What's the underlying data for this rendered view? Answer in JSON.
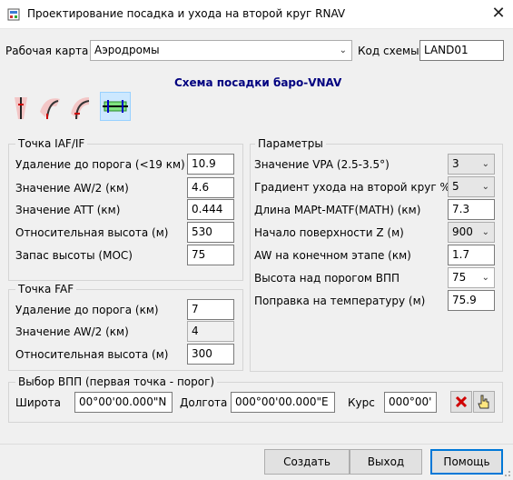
{
  "window": {
    "title": "Проектирование посадка и ухода на второй круг RNAV",
    "close_glyph": "✕"
  },
  "top": {
    "map_label": "Рабочая карта",
    "map_value": "Аэродромы",
    "scheme_code_label": "Код схемы",
    "scheme_code_value": "LAND01"
  },
  "heading": "Схема посадки баро-VNAV",
  "scheme_icons": [
    "approach-scheme-1-icon",
    "approach-scheme-2-icon",
    "approach-scheme-3-icon",
    "approach-scheme-4-icon"
  ],
  "iaf": {
    "legend": "Точка IAF/IF",
    "rows": [
      {
        "label": "Удаление до порога (<19 км)",
        "value": "10.9"
      },
      {
        "label": "Значение AW/2 (км)",
        "value": "4.6"
      },
      {
        "label": "Значение ATT (км)",
        "value": "0.444"
      },
      {
        "label": "Относительная высота (м)",
        "value": "530"
      },
      {
        "label": "Запас высоты (MOC)",
        "value": "75"
      }
    ]
  },
  "faf": {
    "legend": "Точка FAF",
    "rows": [
      {
        "label": "Удаление до порога (км)",
        "value": "7"
      },
      {
        "label": "Значение AW/2 (км)",
        "value": "4"
      },
      {
        "label": "Относительная высота (м)",
        "value": "300"
      }
    ]
  },
  "params": {
    "legend": "Параметры",
    "rows": [
      {
        "label": "Значение VPA (2.5-3.5°)",
        "value": "3",
        "type": "combo-disabled"
      },
      {
        "label": "Градиент ухода на второй круг %",
        "value": "5",
        "type": "combo-disabled"
      },
      {
        "label": "Длина MAPt-MATF(MATH) (км)",
        "value": "7.3",
        "type": "input"
      },
      {
        "label": "Начало поверхности Z (м)",
        "value": "900",
        "type": "combo-disabled"
      },
      {
        "label": "AW на конечном этапе (км)",
        "value": "1.7",
        "type": "input"
      },
      {
        "label": "Высота над порогом ВПП",
        "value": "75",
        "type": "combo"
      },
      {
        "label": "Поправка на температуру (м)",
        "value": "75.9",
        "type": "input"
      }
    ]
  },
  "runway": {
    "legend": "Выбор ВПП (первая точка - порог)",
    "lat_label": "Широта",
    "lat_value": "00°00'00.000\"N",
    "lon_label": "Долгота",
    "lon_value": "000°00'00.000\"E",
    "course_label": "Курс",
    "course_value": "000°00'"
  },
  "buttons": {
    "create": "Создать",
    "exit": "Выход",
    "help": "Помощь"
  },
  "colors": {
    "heading": "#00007f",
    "default_button_border": "#0078d7"
  }
}
